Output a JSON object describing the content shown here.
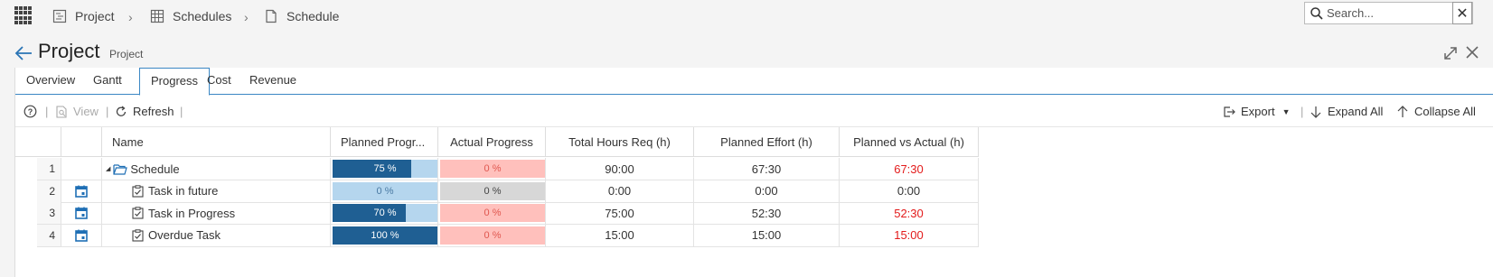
{
  "breadcrumbs": [
    {
      "label": "Project",
      "icon": "project-icon"
    },
    {
      "label": "Schedules",
      "icon": "schedules-grid-icon"
    },
    {
      "label": "Schedule",
      "icon": "document-icon"
    }
  ],
  "search": {
    "placeholder": "Search..."
  },
  "header": {
    "title": "Project",
    "subtitle": "Project"
  },
  "tabs": [
    "Overview",
    "Gantt",
    "Progress",
    "Cost",
    "Revenue"
  ],
  "active_tab": "Progress",
  "toolbar": {
    "view_label": "View",
    "refresh_label": "Refresh",
    "export_label": "Export",
    "expand_all_label": "Expand All",
    "collapse_all_label": "Collapse All"
  },
  "columns": [
    "Name",
    "Planned Progr...",
    "Actual Progress",
    "Total Hours Req (h)",
    "Planned Effort (h)",
    "Planned vs Actual (h)"
  ],
  "rows": [
    {
      "num": "1",
      "name": "Schedule",
      "type": "folder",
      "planned_label": "75 %",
      "planned_pct": 75,
      "actual_label": "0 %",
      "actual_status": "behind",
      "total": "90:00",
      "effort": "67:30",
      "diff": "67:30",
      "diff_alert": true
    },
    {
      "num": "2",
      "name": "Task in future",
      "type": "task",
      "planned_label": "0 %",
      "planned_pct": 0,
      "actual_label": "0 %",
      "actual_status": "neutral",
      "total": "0:00",
      "effort": "0:00",
      "diff": "0:00",
      "diff_alert": false
    },
    {
      "num": "3",
      "name": "Task in Progress",
      "type": "task",
      "planned_label": "70 %",
      "planned_pct": 70,
      "actual_label": "0 %",
      "actual_status": "behind",
      "total": "75:00",
      "effort": "52:30",
      "diff": "52:30",
      "diff_alert": true
    },
    {
      "num": "4",
      "name": "Overdue Task",
      "type": "task",
      "planned_label": "100 %",
      "planned_pct": 100,
      "actual_label": "0 %",
      "actual_status": "behind",
      "total": "15:00",
      "effort": "15:00",
      "diff": "15:00",
      "diff_alert": true
    }
  ],
  "colors": {
    "accent": "#3b87c4",
    "bar_dark": "#1f5f93",
    "bar_light": "#b5d6ee",
    "behind": "#ffc0bc",
    "neutral": "#d7d7d7",
    "alert_text": "#e31b1b"
  }
}
